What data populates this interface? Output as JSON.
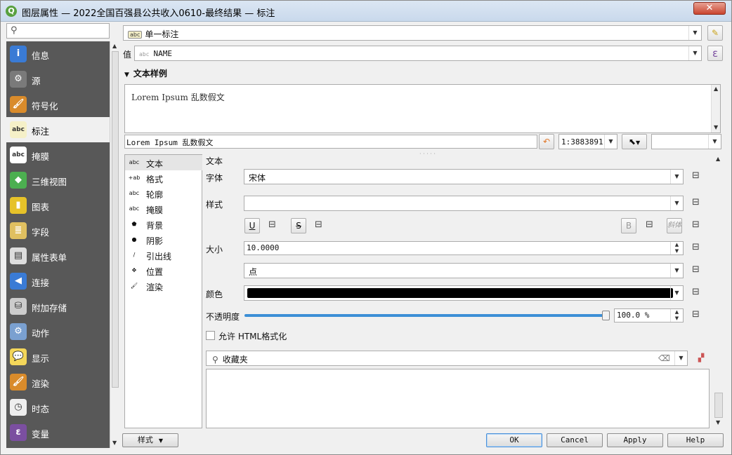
{
  "window": {
    "title": "图层属性 — 2022全国百强县公共收入0610-最终结果 — 标注",
    "close_label": "✕"
  },
  "sidebar": {
    "search_placeholder": "",
    "items": [
      {
        "label": "信息",
        "icon": "info-icon",
        "color": "#3a7bd5",
        "glyph": "i"
      },
      {
        "label": "源",
        "icon": "source-icon",
        "color": "#7a7a7a",
        "glyph": "⚙"
      },
      {
        "label": "符号化",
        "icon": "symbology-icon",
        "color": "#d98b2b",
        "glyph": "🖌"
      },
      {
        "label": "标注",
        "icon": "labels-icon",
        "color": "#f5f0c8",
        "glyph": "abc"
      },
      {
        "label": "掩膜",
        "icon": "mask-icon",
        "color": "#ffffff",
        "glyph": "abc"
      },
      {
        "label": "三维视图",
        "icon": "3d-view-icon",
        "color": "#4caf50",
        "glyph": "◆"
      },
      {
        "label": "图表",
        "icon": "diagram-icon",
        "color": "#e6c229",
        "glyph": "▮"
      },
      {
        "label": "字段",
        "icon": "fields-icon",
        "color": "#e0c060",
        "glyph": "≣"
      },
      {
        "label": "属性表单",
        "icon": "attributes-form-icon",
        "color": "#dddddd",
        "glyph": "▤"
      },
      {
        "label": "连接",
        "icon": "joins-icon",
        "color": "#3a7bd5",
        "glyph": "◀"
      },
      {
        "label": "附加存储",
        "icon": "auxiliary-storage-icon",
        "color": "#cccccc",
        "glyph": "⛁"
      },
      {
        "label": "动作",
        "icon": "actions-icon",
        "color": "#7aa0d0",
        "glyph": "⚙"
      },
      {
        "label": "显示",
        "icon": "display-icon",
        "color": "#f3d65a",
        "glyph": "💬"
      },
      {
        "label": "渲染",
        "icon": "rendering-icon",
        "color": "#d98b2b",
        "glyph": "🖌"
      },
      {
        "label": "时态",
        "icon": "temporal-icon",
        "color": "#eeeeee",
        "glyph": "◷"
      },
      {
        "label": "变量",
        "icon": "variables-icon",
        "color": "#7b4fa0",
        "glyph": "ε"
      }
    ]
  },
  "labeling": {
    "mode": "单一标注",
    "value_label": "值",
    "value_field": "NAME",
    "value_badge": "abc",
    "expr_glyph": "ε"
  },
  "text_sample": {
    "header": "文本样例",
    "preview_text": "Lorem Ipsum 乱数假文",
    "input_text": "Lorem Ipsum 乱数假文",
    "scale": "1:3883891"
  },
  "tabs": [
    {
      "label": "文本",
      "icon": "text-icon",
      "glyph": "abc"
    },
    {
      "label": "格式",
      "icon": "formatting-icon",
      "glyph": "+ab"
    },
    {
      "label": "轮廓",
      "icon": "buffer-icon",
      "glyph": "abc"
    },
    {
      "label": "掩膜",
      "icon": "mask-tab-icon",
      "glyph": "abc"
    },
    {
      "label": "背景",
      "icon": "background-icon",
      "glyph": "⬟"
    },
    {
      "label": "阴影",
      "icon": "shadow-icon",
      "glyph": "●"
    },
    {
      "label": "引出线",
      "icon": "callouts-icon",
      "glyph": "/"
    },
    {
      "label": "位置",
      "icon": "placement-icon",
      "glyph": "✥"
    },
    {
      "label": "渲染",
      "icon": "rendering-tab-icon",
      "glyph": "🖌"
    }
  ],
  "text_panel": {
    "section_title": "文本",
    "font_label": "字体",
    "font_value": "宋体",
    "style_label": "样式",
    "style_value": "",
    "underline": "U",
    "strike": "S",
    "bold": "B",
    "italic": "斜体",
    "size_label": "大小",
    "size_value": "10.0000",
    "unit_value": "点",
    "color_label": "颜色",
    "color_value": "#000000",
    "opacity_label": "不透明度",
    "opacity_value": "100.0 %",
    "opacity_fraction": 1.0,
    "html_label": "允许 HTML格式化",
    "html_checked": false,
    "favorites_placeholder": "收藏夹"
  },
  "footer": {
    "style_button": "样式",
    "ok": "OK",
    "cancel": "Cancel",
    "apply": "Apply",
    "help": "Help"
  }
}
